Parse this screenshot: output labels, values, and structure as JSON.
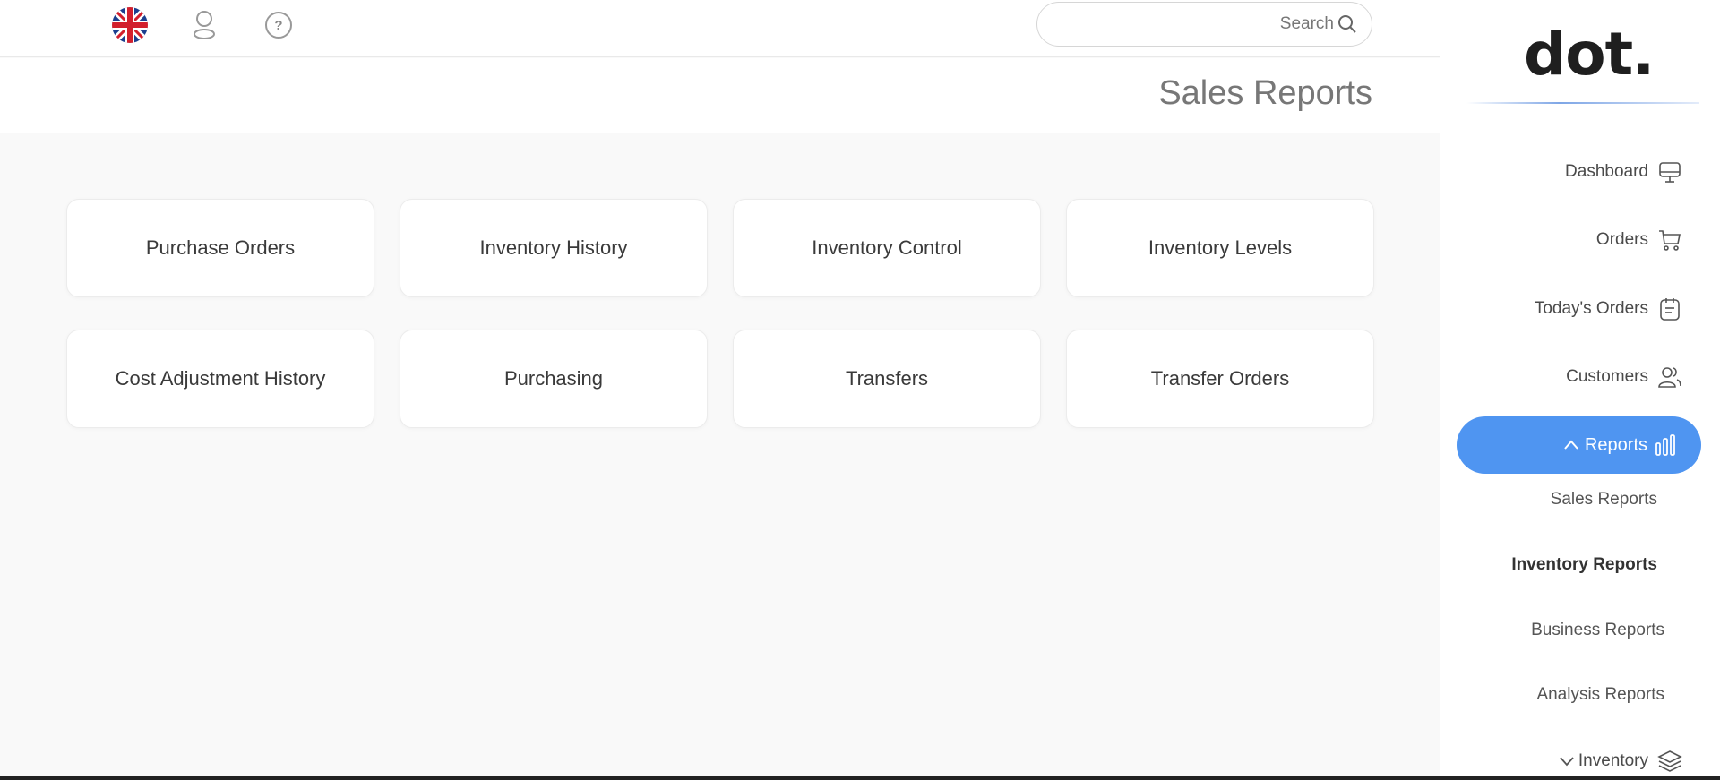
{
  "topbar": {
    "language_icon": "uk-flag-icon",
    "user_icon": "user-icon",
    "help_icon": "help-icon",
    "search_placeholder": "Search",
    "search_icon": "search-icon"
  },
  "page": {
    "title": "Sales Reports"
  },
  "cards": [
    {
      "label": "Purchase Orders"
    },
    {
      "label": "Inventory History"
    },
    {
      "label": "Inventory Control"
    },
    {
      "label": "Inventory Levels"
    },
    {
      "label": "Cost Adjustment History"
    },
    {
      "label": "Purchasing"
    },
    {
      "label": "Transfers"
    },
    {
      "label": "Transfer Orders"
    }
  ],
  "sidebar": {
    "logo": "dot.",
    "nav": {
      "dashboard": {
        "label": "Dashboard",
        "icon": "monitor-icon"
      },
      "orders": {
        "label": "Orders",
        "icon": "cart-icon"
      },
      "todays_orders": {
        "label": "Today's Orders",
        "icon": "clipboard-icon"
      },
      "customers": {
        "label": "Customers",
        "icon": "users-icon"
      },
      "reports": {
        "label": "Reports",
        "icon": "bar-chart-icon",
        "expanded": true
      },
      "inventory": {
        "label": "Inventory",
        "icon": "layers-icon",
        "expanded": false
      }
    },
    "reports_submenu": {
      "sales": "Sales Reports",
      "inventory": "Inventory Reports",
      "business": "Business Reports",
      "analysis": "Analysis Reports"
    }
  },
  "colors": {
    "accent": "#4f95f1",
    "background": "#f9f9f9",
    "card": "#ffffff"
  }
}
